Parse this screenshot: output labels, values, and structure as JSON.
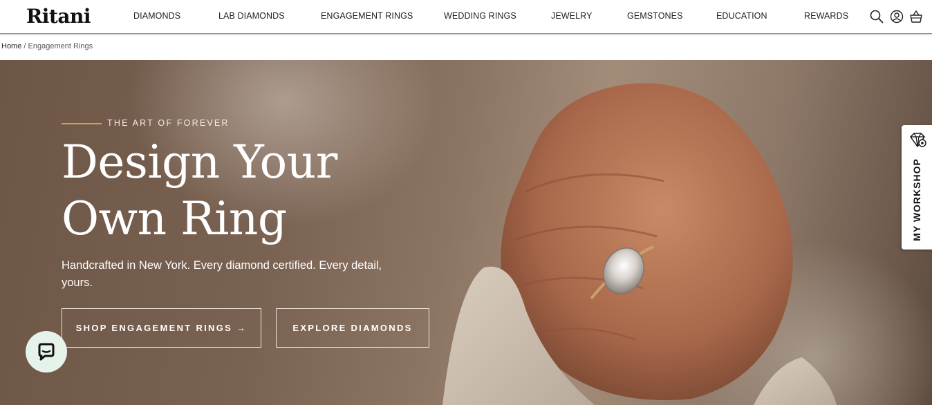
{
  "header": {
    "logo": "Ritani",
    "nav": [
      {
        "label": "DIAMONDS"
      },
      {
        "label": "LAB DIAMONDS"
      },
      {
        "label": "ENGAGEMENT RINGS"
      },
      {
        "label": "WEDDING RINGS"
      },
      {
        "label": "JEWELRY"
      },
      {
        "label": "GEMSTONES"
      },
      {
        "label": "EDUCATION"
      },
      {
        "label": "REWARDS"
      }
    ],
    "icons": [
      "search-icon",
      "account-icon",
      "cart-icon"
    ]
  },
  "breadcrumb": {
    "home": "Home",
    "separator": " / ",
    "current": "Engagement Rings"
  },
  "hero": {
    "eyebrow": "THE ART OF FOREVER",
    "title_line1": "Design Your",
    "title_line2": "Own Ring",
    "subtitle": "Handcrafted in New York. Every diamond certified. Every detail, yours.",
    "primary_button": "SHOP ENGAGEMENT RINGS →",
    "secondary_button": "EXPLORE DIAMONDS"
  },
  "workshop_tab": {
    "label": "MY WORKSHOP",
    "icon": "diamond-gear-icon"
  },
  "chat": {
    "icon": "chat-bubble-icon"
  },
  "colors": {
    "accent_line": "#c7a55b",
    "hero_bg": "#7a6252",
    "text_dark": "#111111"
  }
}
